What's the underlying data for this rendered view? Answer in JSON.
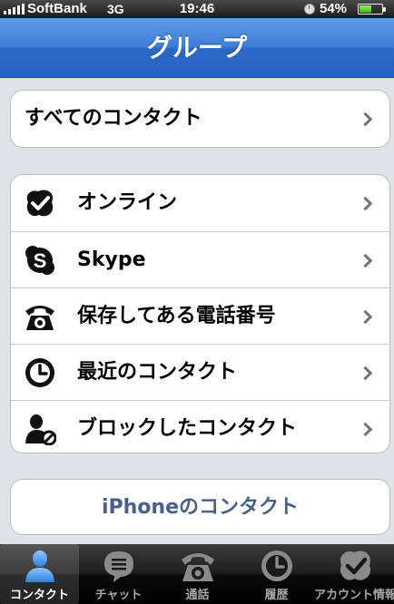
{
  "status_bar": {
    "carrier": "SoftBank",
    "network": "3G",
    "time": "19:46",
    "battery": "54%",
    "battery_level": 0.54,
    "icons": [
      "signal-bars-icon",
      "lock-rotation-icon",
      "battery-icon"
    ]
  },
  "nav": {
    "title": "グループ"
  },
  "all_contacts": {
    "label": "すべてのコンタクト"
  },
  "groups": [
    {
      "label": "オンライン",
      "icon": "online-check-icon"
    },
    {
      "label": "Skype",
      "icon": "skype-icon"
    },
    {
      "label": "保存してある電話番号",
      "icon": "telephone-icon"
    },
    {
      "label": "最近のコンタクト",
      "icon": "clock-icon"
    },
    {
      "label": "ブロックしたコンタクト",
      "icon": "blocked-user-icon"
    }
  ],
  "iphone_contacts": {
    "label": "iPhoneのコンタクト"
  },
  "colors": {
    "nav_blue": "#3f7fd6",
    "link_blue": "#466089",
    "tab_active_text": "#ffffff",
    "tab_inactive_text": "#a7a7a7"
  },
  "tabs": [
    {
      "label": "コンタクト",
      "icon": "contacts-person-icon",
      "active": true
    },
    {
      "label": "チャット",
      "icon": "chat-bubble-icon",
      "active": false
    },
    {
      "label": "通話",
      "icon": "phone-icon",
      "active": false
    },
    {
      "label": "履歴",
      "icon": "history-clock-icon",
      "active": false
    },
    {
      "label": "アカウント情報",
      "icon": "account-check-icon",
      "active": false
    }
  ]
}
